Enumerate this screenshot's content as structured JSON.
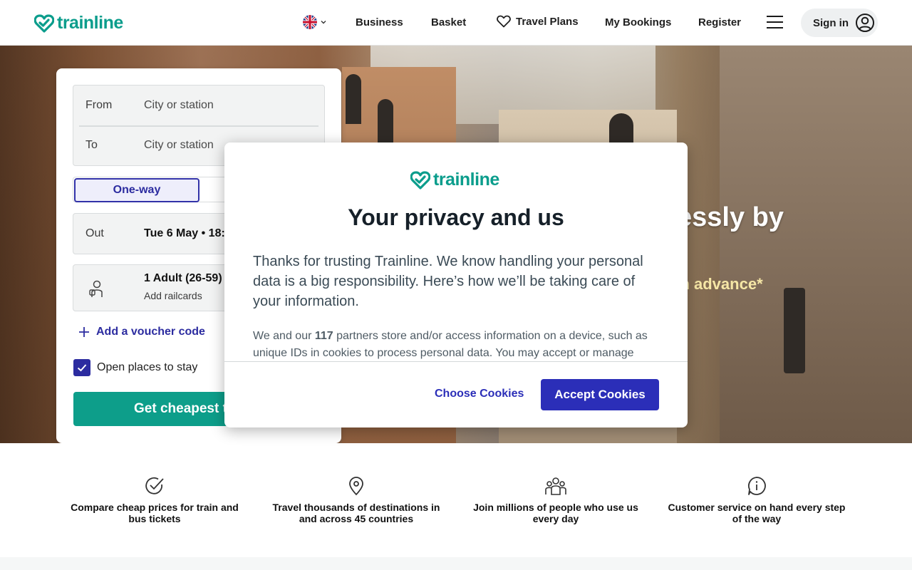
{
  "header": {
    "logo_text": "trainline",
    "nav": {
      "business": "Business",
      "basket": "Basket",
      "travel_plans": "Travel Plans",
      "my_bookings": "My Bookings",
      "register": "Register",
      "sign_in": "Sign in"
    }
  },
  "hero": {
    "headline_fragment": "essly by",
    "sub_fragment": "k in advance*"
  },
  "search": {
    "from_label": "From",
    "from_placeholder": "City or station",
    "to_label": "To",
    "to_placeholder": "City or station",
    "tab_oneway": "One-way",
    "out_label": "Out",
    "out_value": "Tue 6 May • 18:",
    "passengers": "1 Adult (26-59)",
    "railcards_link": "Add railcards",
    "voucher_link": "Add a voucher code",
    "stay_label": "Open places to stay",
    "stay_checked": true,
    "cta_label": "Get cheapest t"
  },
  "features": [
    {
      "icon": "check-circle-icon",
      "text": "Compare cheap prices for train and bus tickets"
    },
    {
      "icon": "map-pin-icon",
      "text": "Travel thousands of destinations in and across 45 countries"
    },
    {
      "icon": "people-icon",
      "text": "Join millions of people who use us every day"
    },
    {
      "icon": "info-bubble-icon",
      "text": "Customer service on hand every step of the way"
    }
  ],
  "modal": {
    "logo_text": "trainline",
    "title": "Your privacy and us",
    "lead": "Thanks for trusting Trainline. We know handling your personal data is a big responsibility. Here’s how we’ll be taking care of your information.",
    "body_prefix": "We and our ",
    "partners_count": "117",
    "body_suffix": " partners store and/or access information on a device, such as unique IDs in cookies to process personal data. You may accept or manage",
    "choose_label": "Choose Cookies",
    "accept_label": "Accept Cookies"
  },
  "colors": {
    "brand_teal": "#0b9d8c",
    "primary_blue": "#2b2eb8",
    "hero_accent_yellow": "#f6e7a6"
  }
}
